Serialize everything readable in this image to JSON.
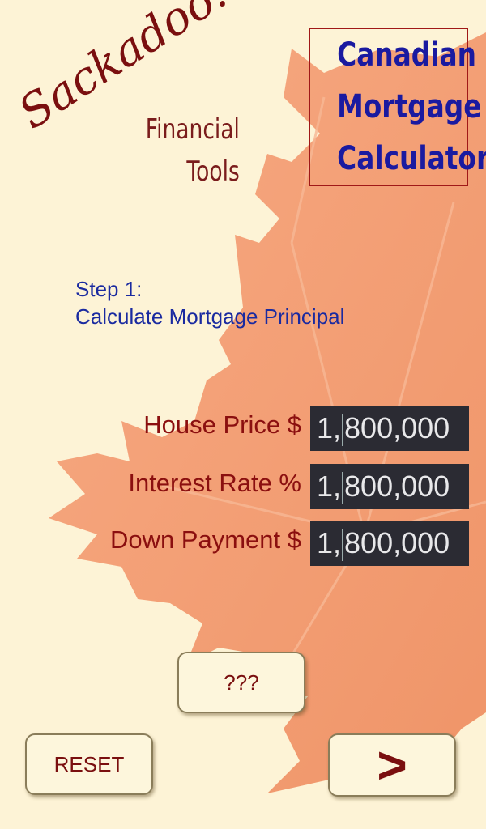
{
  "brand": {
    "name": "Sackadoo!",
    "subtitle_line1": "Financial",
    "subtitle_line2": "Tools"
  },
  "title_box": {
    "line1": "Canadian",
    "line2": "Mortgage",
    "line3": "Calculator"
  },
  "step": {
    "number_label": "Step 1:",
    "description": "Calculate Mortgage Principal"
  },
  "fields": [
    {
      "label": "House Price $",
      "value_before_caret": "1,",
      "value_after_caret": "800,000"
    },
    {
      "label": "Interest Rate %",
      "value_before_caret": "1,",
      "value_after_caret": "800,000"
    },
    {
      "label": "Down Payment $",
      "value_before_caret": "1,",
      "value_after_caret": "800,000"
    }
  ],
  "buttons": {
    "help_label": "???",
    "reset_label": "RESET",
    "next_label": ">"
  },
  "colors": {
    "background": "#fdf3d6",
    "leaf": "#f29a6c",
    "brand_red": "#7a0f0f",
    "title_blue": "#1a1aa0",
    "input_bg": "#2b2b33"
  }
}
